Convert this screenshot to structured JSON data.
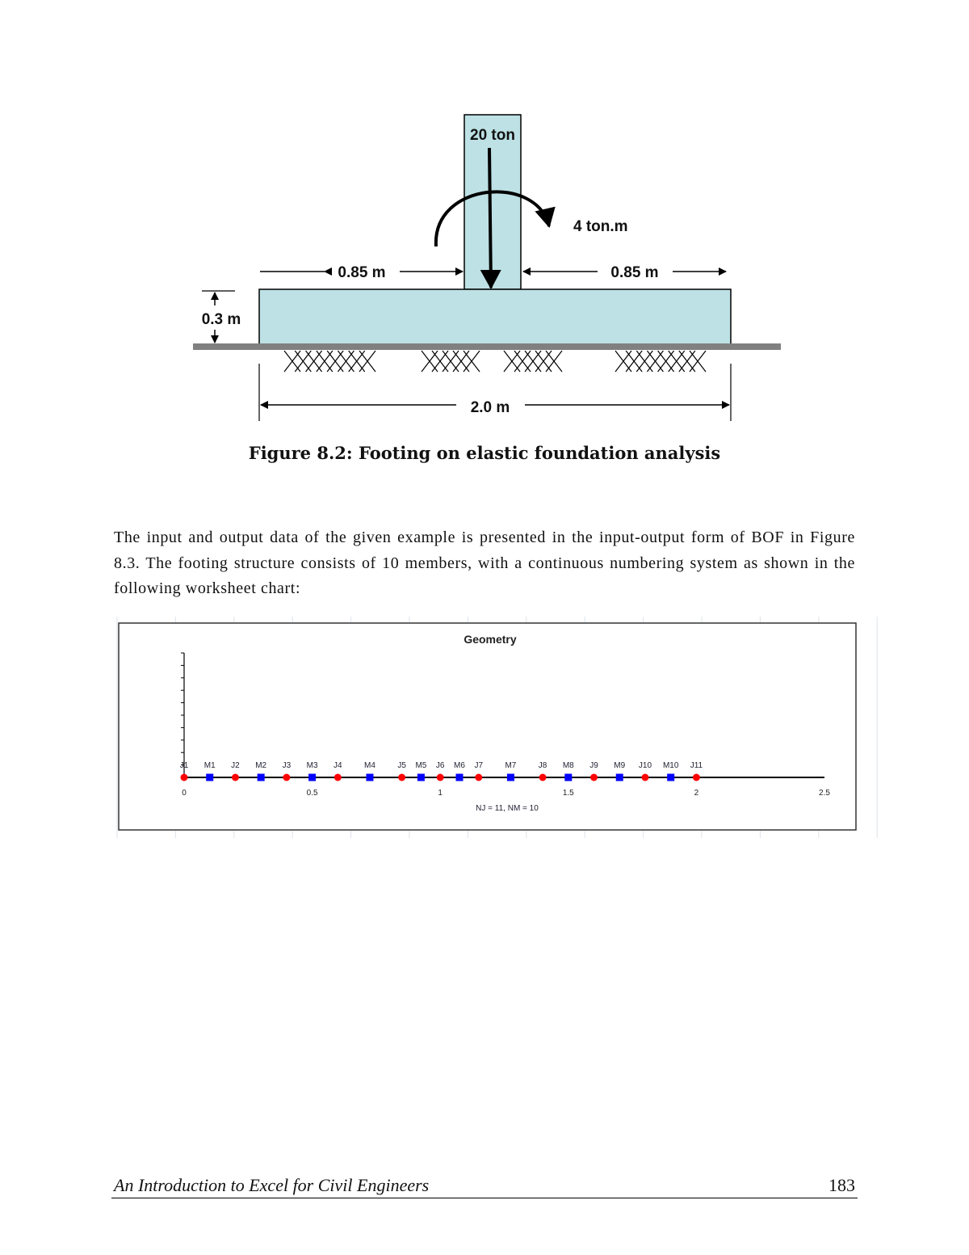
{
  "figure": {
    "load_label": "20 ton",
    "moment_label": "4 ton.m",
    "left_dim_label": "0.85 m",
    "right_dim_label": "0.85 m",
    "thickness_label": "0.3 m",
    "width_label": "2.0 m",
    "fill_color": "#bde1e4",
    "ground_color": "#808080",
    "caption": "Figure 8.2: Footing on elastic foundation analysis"
  },
  "paragraph": "The input and output data of the given example is presented in the input-output form of BOF in Figure 8.3. The footing structure consists of 10 members, with a continuous numbering system as shown in the following worksheet chart:",
  "chart_data": {
    "type": "scatter",
    "title": "Geometry",
    "xlabel": "NJ = 11, NM = 10",
    "xlim": [
      0,
      2.5
    ],
    "xticks": [
      "0",
      "0.5",
      "1",
      "1.5",
      "2",
      "2.5"
    ],
    "grid": false,
    "series": [
      {
        "kind": "joints",
        "color": "#ff0000",
        "marker": "circle",
        "labels": [
          "J1",
          "J2",
          "J3",
          "J4",
          "J5",
          "J6",
          "J7",
          "J8",
          "J9",
          "J10",
          "J11"
        ],
        "x": [
          0,
          0.2,
          0.4,
          0.6,
          0.85,
          1.0,
          1.15,
          1.4,
          1.6,
          1.8,
          2.0
        ]
      },
      {
        "kind": "members",
        "color": "#0000ff",
        "marker": "square",
        "labels": [
          "M1",
          "M2",
          "M3",
          "M4",
          "M5",
          "M6",
          "M7",
          "M8",
          "M9",
          "M10"
        ],
        "x": [
          0.1,
          0.3,
          0.5,
          0.725,
          0.925,
          1.075,
          1.275,
          1.5,
          1.7,
          1.9
        ]
      }
    ]
  },
  "footer": {
    "title": "An Introduction to Excel for Civil Engineers",
    "page": "183"
  }
}
